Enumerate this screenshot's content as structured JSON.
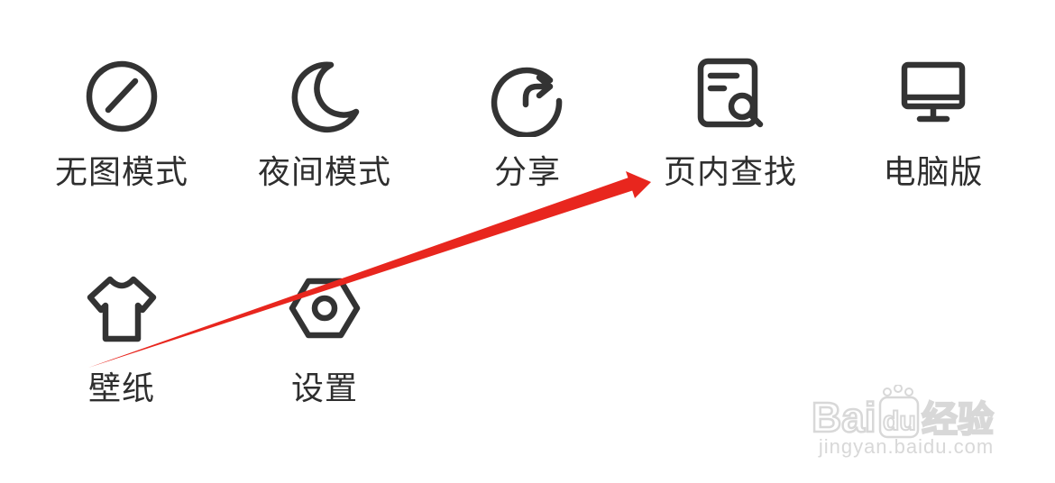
{
  "menu": {
    "row1": [
      {
        "label": "无图模式",
        "icon": "no-image-icon"
      },
      {
        "label": "夜间模式",
        "icon": "moon-icon"
      },
      {
        "label": "分享",
        "icon": "share-icon"
      },
      {
        "label": "页内查找",
        "icon": "find-in-page-icon"
      },
      {
        "label": "电脑版",
        "icon": "desktop-icon"
      }
    ],
    "row2": [
      {
        "label": "壁纸",
        "icon": "tshirt-icon"
      },
      {
        "label": "设置",
        "icon": "hex-nut-settings-icon"
      }
    ]
  },
  "colors": {
    "icon_stroke": "#333333",
    "text": "#2e2e2e",
    "arrow": "#e8261e",
    "watermark": "#d8d8d8"
  },
  "watermark": {
    "logo_text": "Baidu经验",
    "url": "jingyan.baidu.com"
  }
}
